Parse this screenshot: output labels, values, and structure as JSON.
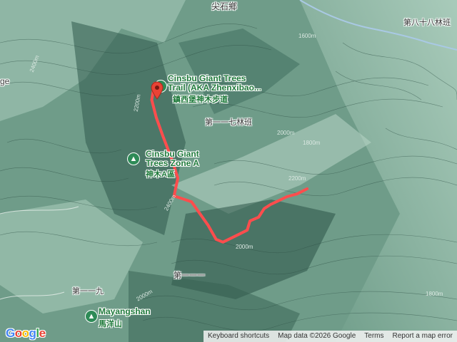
{
  "map": {
    "type": "terrain",
    "track_color": "#ff4d4d",
    "track_points_frac": [
      [
        0.338,
        0.244
      ],
      [
        0.332,
        0.292
      ],
      [
        0.342,
        0.344
      ],
      [
        0.356,
        0.396
      ],
      [
        0.378,
        0.473
      ],
      [
        0.389,
        0.521
      ],
      [
        0.381,
        0.573
      ],
      [
        0.419,
        0.59
      ],
      [
        0.455,
        0.658
      ],
      [
        0.473,
        0.7
      ],
      [
        0.488,
        0.708
      ],
      [
        0.523,
        0.685
      ],
      [
        0.541,
        0.673
      ],
      [
        0.547,
        0.646
      ],
      [
        0.566,
        0.635
      ],
      [
        0.578,
        0.61
      ],
      [
        0.592,
        0.598
      ],
      [
        0.608,
        0.588
      ],
      [
        0.628,
        0.575
      ],
      [
        0.65,
        0.567
      ],
      [
        0.672,
        0.552
      ]
    ]
  },
  "labels": {
    "village": "尖石鄉",
    "forest_88": "第八十八林班",
    "forest_117": "第一一七林班",
    "forest_111": "第一一一",
    "forest_119": "第一一九",
    "edge_left": "ge",
    "trail_en_1": "Cinsbu Giant Trees",
    "trail_en_2": "Trail (AKA Zhenxibao...",
    "trail_zh": "鎮西堡神木步道",
    "zone_en_1": "Cinsbu Giant",
    "zone_en_2": "Trees Zone A",
    "zone_zh": "神木A區",
    "mountain_en": "Mayangshan",
    "mountain_zh": "馬洋山"
  },
  "contours": [
    "2400m",
    "2000m",
    "2200m",
    "1800m",
    "1600m",
    "2200m",
    "2400m",
    "2000m",
    "2000m",
    "1800m"
  ],
  "icons": {
    "trail_marker": "trailhead-pin-icon",
    "zone": "tree-icon",
    "mountain": "hiking-icon"
  },
  "attribution": {
    "logo": "Google",
    "shortcuts": "Keyboard shortcuts",
    "map_data": "Map data ©2026 Google",
    "terms": "Terms",
    "report": "Report a map error"
  }
}
